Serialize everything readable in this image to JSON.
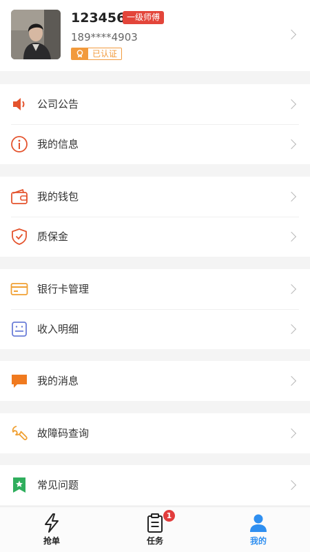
{
  "profile": {
    "username": "123456",
    "level": "一级师傅",
    "phone": "189****4903",
    "verified": "已认证"
  },
  "menu_groups": [
    {
      "items": [
        {
          "label": "公司公告",
          "icon": "speaker-icon"
        },
        {
          "label": "我的信息",
          "icon": "info-icon"
        }
      ]
    },
    {
      "items": [
        {
          "label": "我的钱包",
          "icon": "wallet-icon"
        },
        {
          "label": "质保金",
          "icon": "shield-check-icon"
        }
      ]
    },
    {
      "items": [
        {
          "label": "银行卡管理",
          "icon": "bank-card-icon"
        },
        {
          "label": "收入明细",
          "icon": "income-list-icon"
        }
      ]
    },
    {
      "items": [
        {
          "label": "我的消息",
          "icon": "message-icon"
        }
      ]
    },
    {
      "items": [
        {
          "label": "故障码查询",
          "icon": "wrench-icon"
        }
      ]
    },
    {
      "items": [
        {
          "label": "常见问题",
          "icon": "bookmark-star-icon"
        }
      ]
    }
  ],
  "tabbar": {
    "tabs": [
      {
        "label": "抢单",
        "icon": "lightning-icon"
      },
      {
        "label": "任务",
        "icon": "clipboard-icon",
        "badge": "1"
      },
      {
        "label": "我的",
        "icon": "user-icon",
        "active": true
      }
    ]
  },
  "colors": {
    "badge_red": "#e3453a",
    "verified_orange": "#f29a3c",
    "active_blue": "#2f8ff0"
  }
}
